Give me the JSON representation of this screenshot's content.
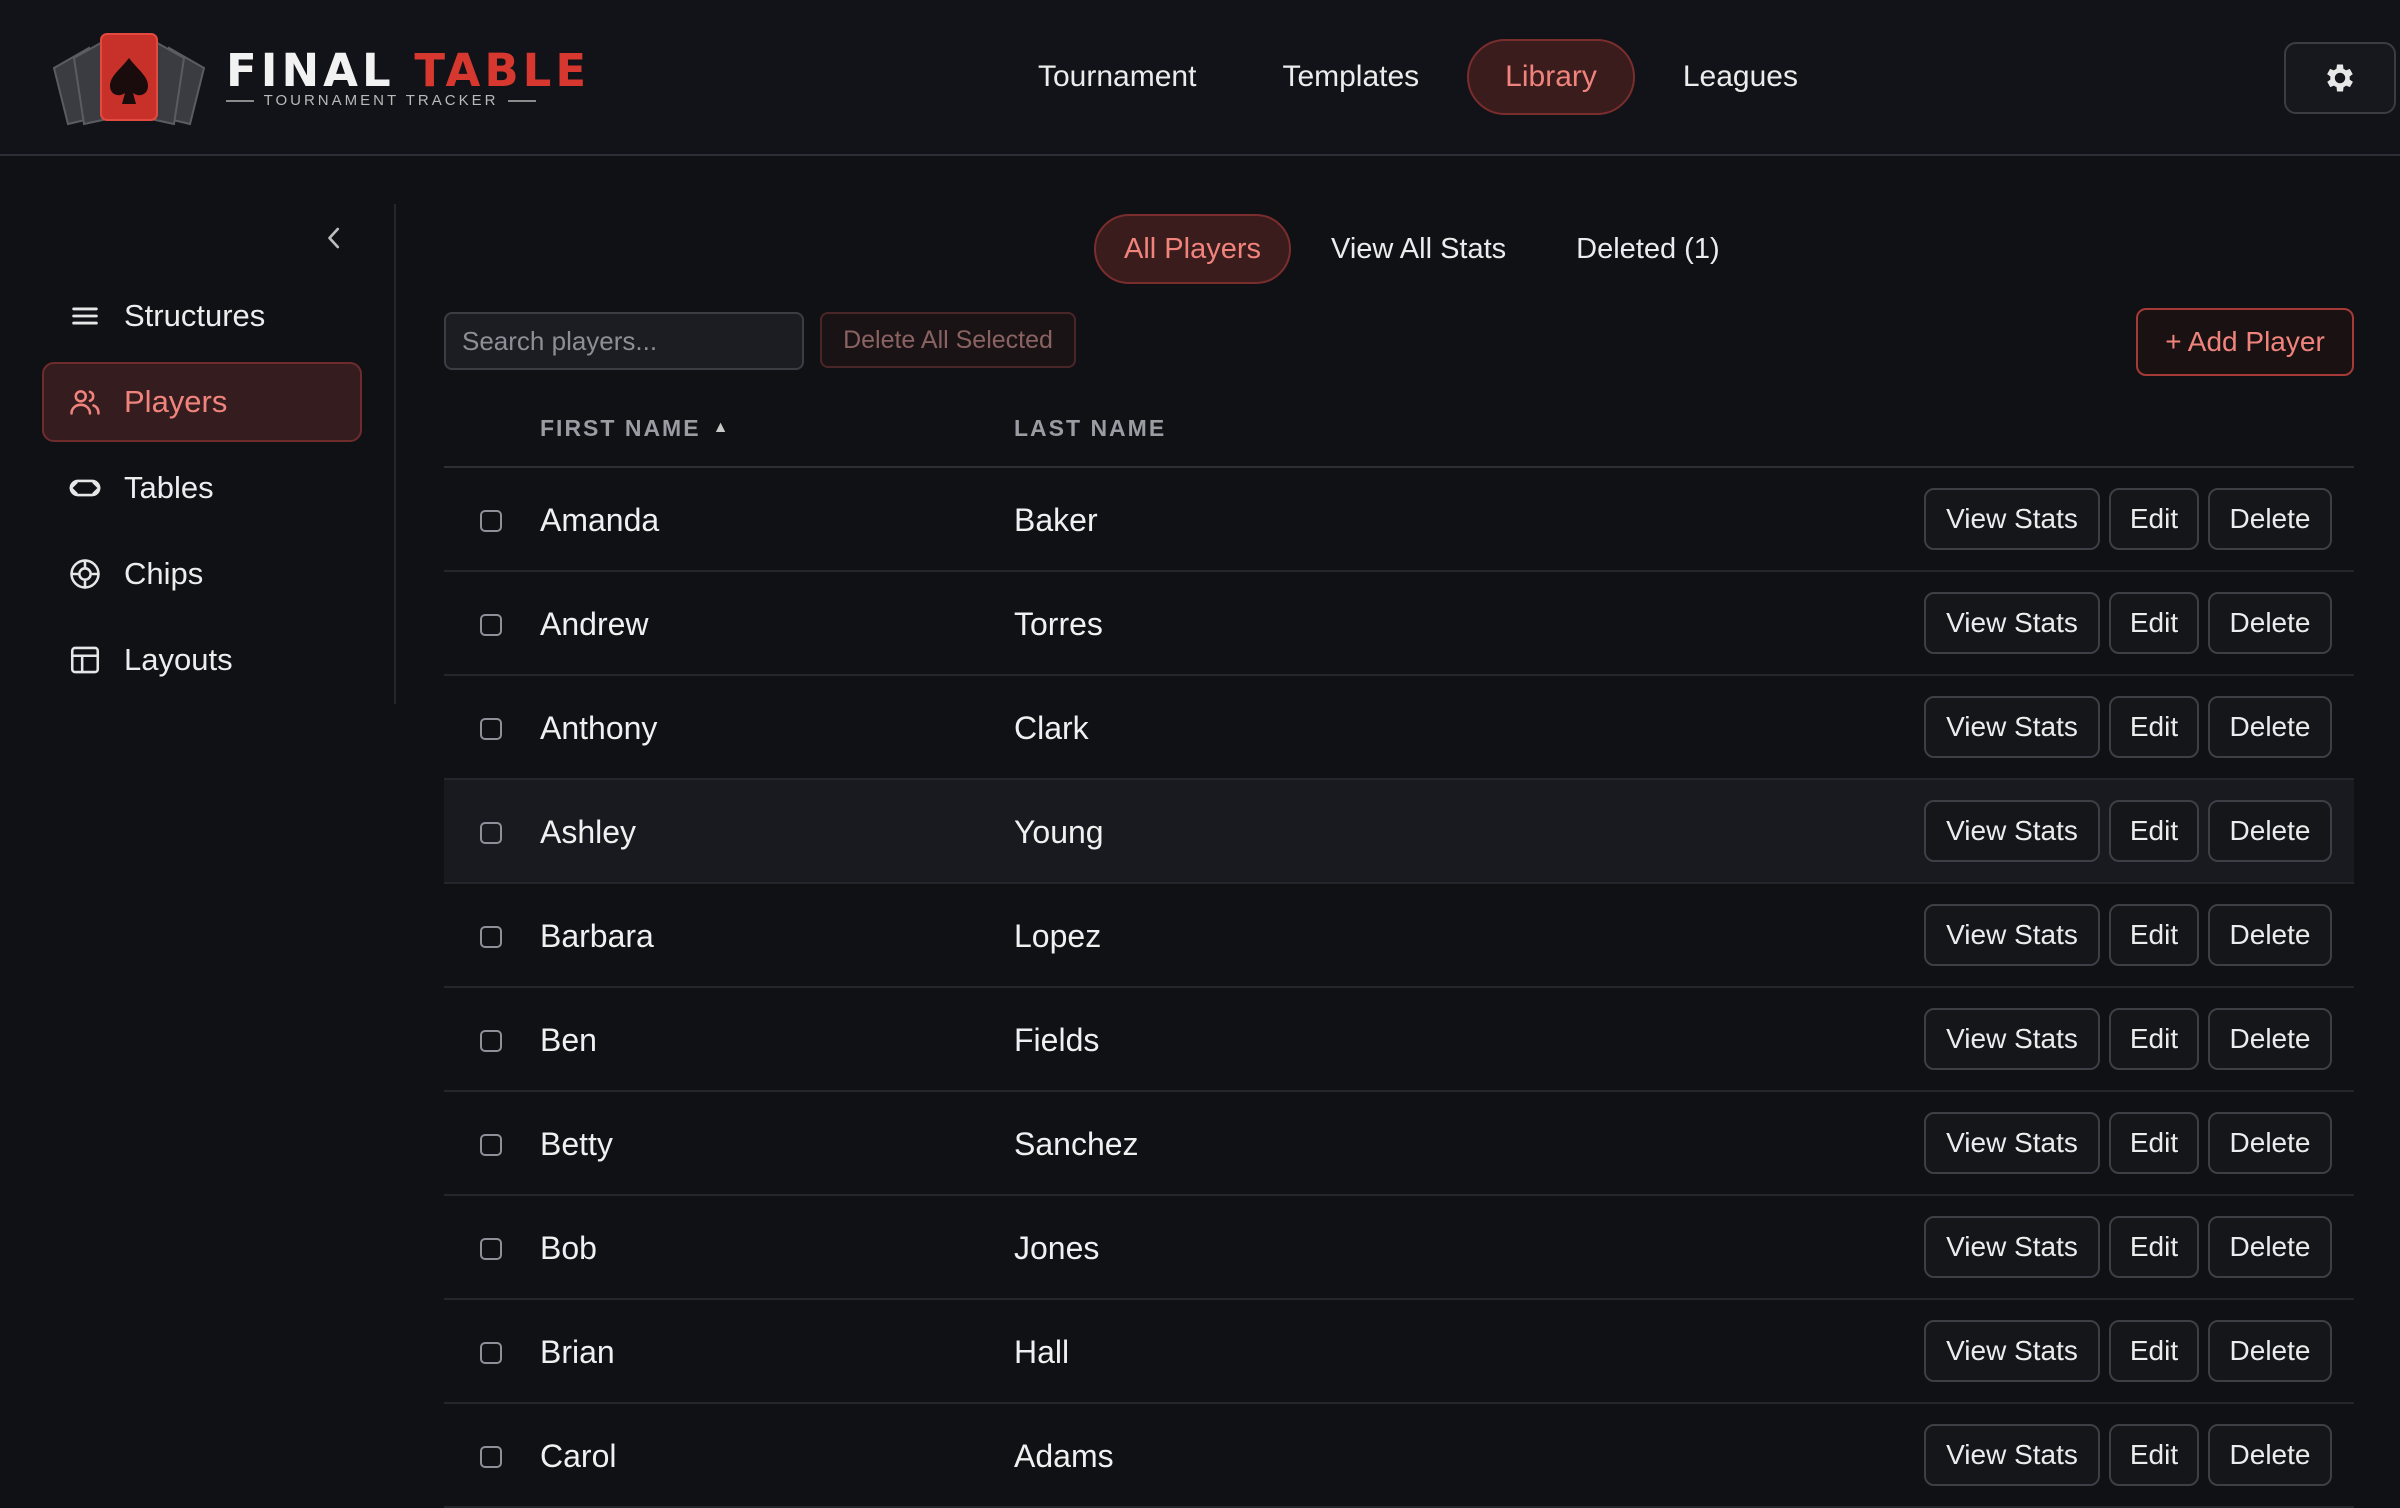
{
  "brand": {
    "title_main": "FINAL",
    "title_accent": "TABLE",
    "subtitle": "TOURNAMENT TRACKER",
    "accent_color": "#d6372e"
  },
  "topnav": {
    "items": [
      {
        "label": "Tournament",
        "active": false
      },
      {
        "label": "Templates",
        "active": false
      },
      {
        "label": "Library",
        "active": true
      },
      {
        "label": "Leagues",
        "active": false
      }
    ],
    "settings_icon": "gear-icon"
  },
  "sidebar": {
    "collapse_icon": "chevron-left-icon",
    "items": [
      {
        "label": "Structures",
        "icon": "list-icon",
        "active": false
      },
      {
        "label": "Players",
        "icon": "users-icon",
        "active": true
      },
      {
        "label": "Tables",
        "icon": "table-oval-icon",
        "active": false
      },
      {
        "label": "Chips",
        "icon": "chip-icon",
        "active": false
      },
      {
        "label": "Layouts",
        "icon": "layout-icon",
        "active": false
      }
    ]
  },
  "subtabs": [
    {
      "label": "All Players",
      "active": true
    },
    {
      "label": "View All Stats",
      "active": false
    },
    {
      "label": "Deleted (1)",
      "active": false
    }
  ],
  "toolbar": {
    "search_placeholder": "Search players...",
    "search_value": "",
    "delete_selected_label": "Delete All Selected",
    "add_player_label": "+ Add Player"
  },
  "table": {
    "columns": {
      "first": "FIRST NAME",
      "last": "LAST NAME",
      "sort_indicator": "▲"
    },
    "actions": {
      "stats": "View Stats",
      "edit": "Edit",
      "delete": "Delete"
    },
    "rows": [
      {
        "first": "Amanda",
        "last": "Baker"
      },
      {
        "first": "Andrew",
        "last": "Torres"
      },
      {
        "first": "Anthony",
        "last": "Clark"
      },
      {
        "first": "Ashley",
        "last": "Young"
      },
      {
        "first": "Barbara",
        "last": "Lopez"
      },
      {
        "first": "Ben",
        "last": "Fields"
      },
      {
        "first": "Betty",
        "last": "Sanchez"
      },
      {
        "first": "Bob",
        "last": "Jones"
      },
      {
        "first": "Brian",
        "last": "Hall"
      },
      {
        "first": "Carol",
        "last": "Adams"
      }
    ]
  }
}
